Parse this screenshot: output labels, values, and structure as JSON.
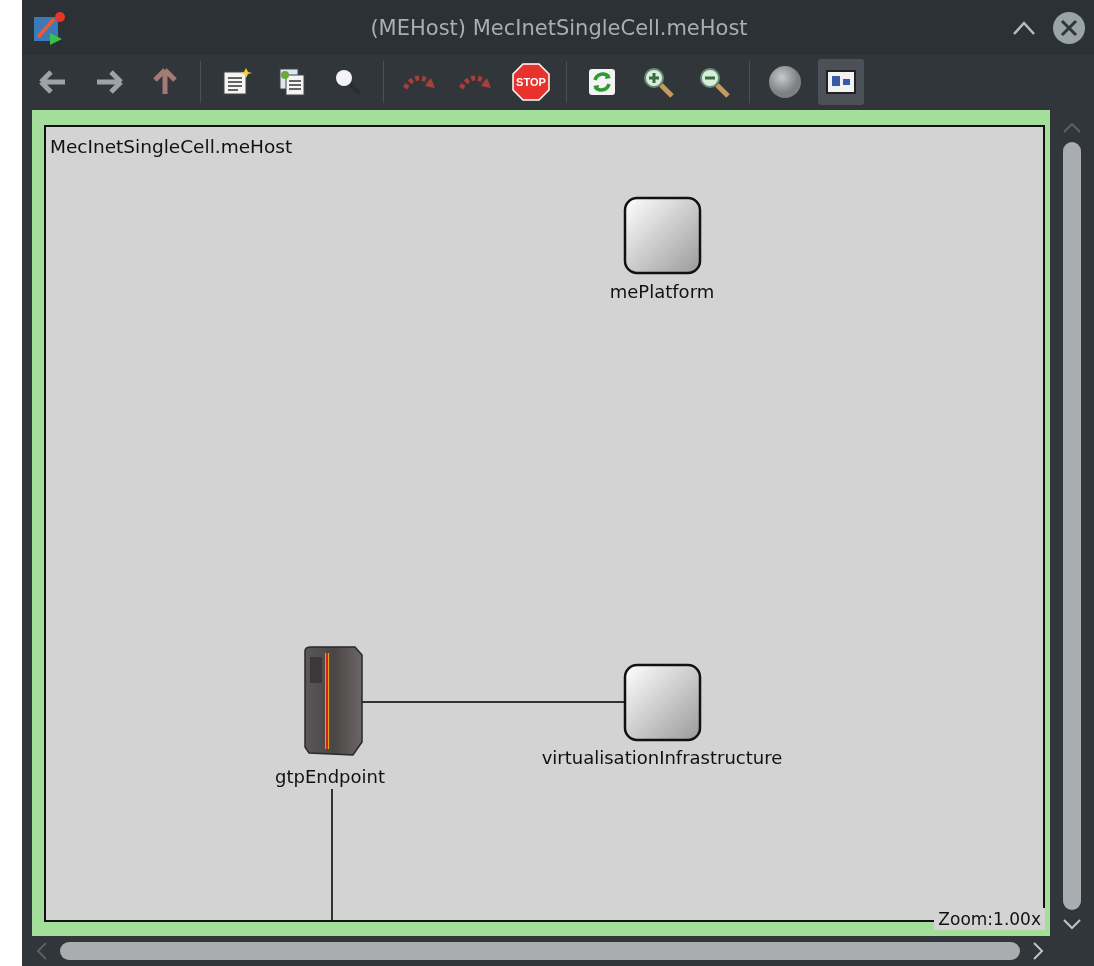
{
  "window": {
    "title": "(MEHost) MecInetSingleCell.meHost"
  },
  "toolbar": {
    "groups": [
      [
        {
          "kind": "back"
        },
        {
          "kind": "forward"
        },
        {
          "kind": "up"
        }
      ],
      [
        {
          "kind": "new-doc"
        },
        {
          "kind": "copy-doc"
        },
        {
          "kind": "find"
        }
      ],
      [
        {
          "kind": "step"
        },
        {
          "kind": "step"
        },
        {
          "kind": "stop",
          "text": "STOP"
        }
      ],
      [
        {
          "kind": "refresh"
        },
        {
          "kind": "zoom-in"
        },
        {
          "kind": "zoom-out"
        }
      ],
      [
        {
          "kind": "ball"
        },
        {
          "kind": "layout",
          "selected": true
        }
      ]
    ]
  },
  "canvas": {
    "title": "MecInetSingleCell.meHost",
    "nodes": [
      {
        "kind": "module",
        "label": "mePlatform"
      },
      {
        "kind": "server",
        "label": "gtpEndpoint"
      },
      {
        "kind": "module",
        "label": "virtualisationInfrastructure"
      }
    ],
    "zoom": "Zoom:1.00x"
  }
}
